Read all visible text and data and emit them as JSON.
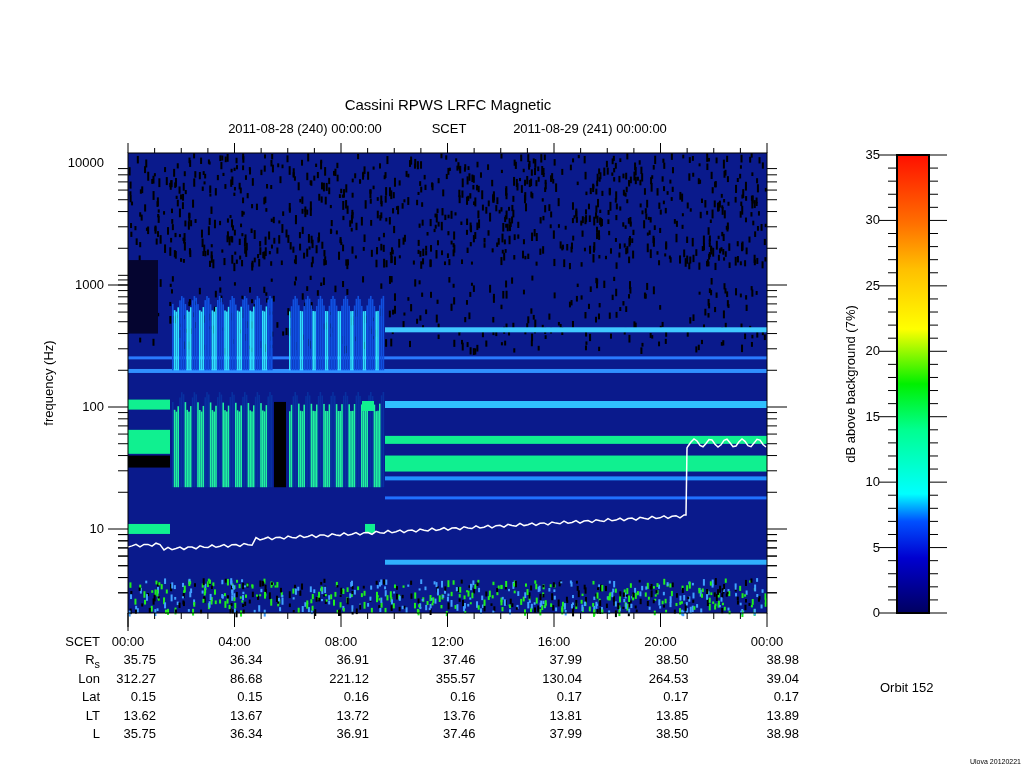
{
  "title": "Cassini RPWS LRFC Magnetic",
  "time_range": {
    "start": "2011-08-28 (240) 00:00:00",
    "label": "SCET",
    "end": "2011-08-29 (241) 00:00:00"
  },
  "frequency_axis": {
    "label": "frequency (Hz)",
    "ticks": [
      "10000",
      "1000",
      "100",
      "10"
    ]
  },
  "colorbar": {
    "label": "dB above background (7%)",
    "ticks": [
      "35",
      "30",
      "25",
      "20",
      "15",
      "10",
      "5",
      "0"
    ]
  },
  "ephemeris": [
    {
      "label": "SCET",
      "kind": "time",
      "values": [
        "00:00",
        "04:00",
        "08:00",
        "12:00",
        "16:00",
        "20:00",
        "00:00"
      ]
    },
    {
      "label": "R$_{s}$",
      "kind": "number",
      "values": [
        "35.75",
        "36.34",
        "36.91",
        "37.46",
        "37.99",
        "38.50",
        "38.98"
      ]
    },
    {
      "label": "Lon",
      "kind": "number",
      "values": [
        "312.27",
        "86.68",
        "221.12",
        "355.57",
        "130.04",
        "264.53",
        "39.04"
      ]
    },
    {
      "label": "Lat",
      "kind": "number",
      "values": [
        "0.15",
        "0.15",
        "0.16",
        "0.16",
        "0.17",
        "0.17",
        "0.17"
      ]
    },
    {
      "label": "LT",
      "kind": "number",
      "values": [
        "13.62",
        "13.67",
        "13.72",
        "13.76",
        "13.81",
        "13.85",
        "13.89"
      ]
    },
    {
      "label": "L",
      "kind": "number",
      "values": [
        "35.75",
        "36.34",
        "36.91",
        "37.46",
        "37.99",
        "38.50",
        "38.98"
      ]
    }
  ],
  "orbit": "Orbit 152",
  "footer": "Ulova 20120221"
}
